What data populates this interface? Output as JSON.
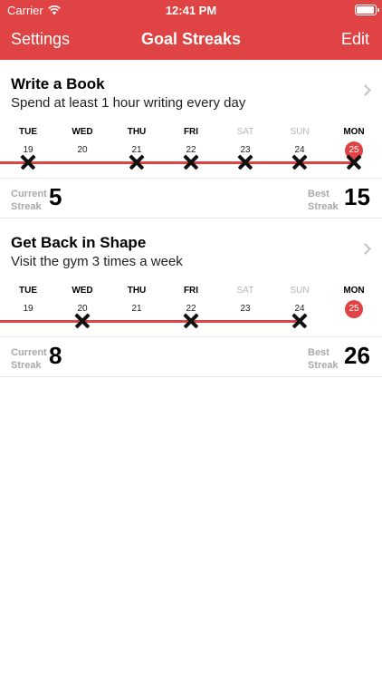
{
  "status_bar": {
    "carrier": "Carrier",
    "time": "12:41 PM",
    "wifi_icon": "wifi-icon",
    "battery_icon": "battery-icon"
  },
  "nav": {
    "left": "Settings",
    "title": "Goal Streaks",
    "right": "Edit"
  },
  "colors": {
    "accent": "#e04344",
    "weekend_text": "#b5b5b5",
    "label_gray": "#a9a9a9"
  },
  "goals": [
    {
      "title": "Write a Book",
      "description": "Spend at least 1 hour writing every day",
      "days": [
        {
          "name": "TUE",
          "num": "19",
          "done": true,
          "weekend": false,
          "today": false
        },
        {
          "name": "WED",
          "num": "20",
          "done": false,
          "weekend": false,
          "today": false
        },
        {
          "name": "THU",
          "num": "21",
          "done": true,
          "weekend": false,
          "today": false
        },
        {
          "name": "FRI",
          "num": "22",
          "done": true,
          "weekend": false,
          "today": false
        },
        {
          "name": "SAT",
          "num": "23",
          "done": true,
          "weekend": true,
          "today": false
        },
        {
          "name": "SUN",
          "num": "24",
          "done": true,
          "weekend": true,
          "today": false
        },
        {
          "name": "MON",
          "num": "25",
          "done": true,
          "weekend": false,
          "today": true
        }
      ],
      "current_label_1": "Current",
      "current_label_2": "Streak",
      "current_value": "5",
      "best_label_1": "Best",
      "best_label_2": "Streak",
      "best_value": "15"
    },
    {
      "title": "Get Back in Shape",
      "description": "Visit the gym 3 times a week",
      "days": [
        {
          "name": "TUE",
          "num": "19",
          "done": false,
          "weekend": false,
          "today": false
        },
        {
          "name": "WED",
          "num": "20",
          "done": true,
          "weekend": false,
          "today": false
        },
        {
          "name": "THU",
          "num": "21",
          "done": false,
          "weekend": false,
          "today": false
        },
        {
          "name": "FRI",
          "num": "22",
          "done": true,
          "weekend": false,
          "today": false
        },
        {
          "name": "SAT",
          "num": "23",
          "done": false,
          "weekend": true,
          "today": false
        },
        {
          "name": "SUN",
          "num": "24",
          "done": true,
          "weekend": true,
          "today": false
        },
        {
          "name": "MON",
          "num": "25",
          "done": false,
          "weekend": false,
          "today": true
        }
      ],
      "current_label_1": "Current",
      "current_label_2": "Streak",
      "current_value": "8",
      "best_label_1": "Best",
      "best_label_2": "Streak",
      "best_value": "26"
    }
  ]
}
